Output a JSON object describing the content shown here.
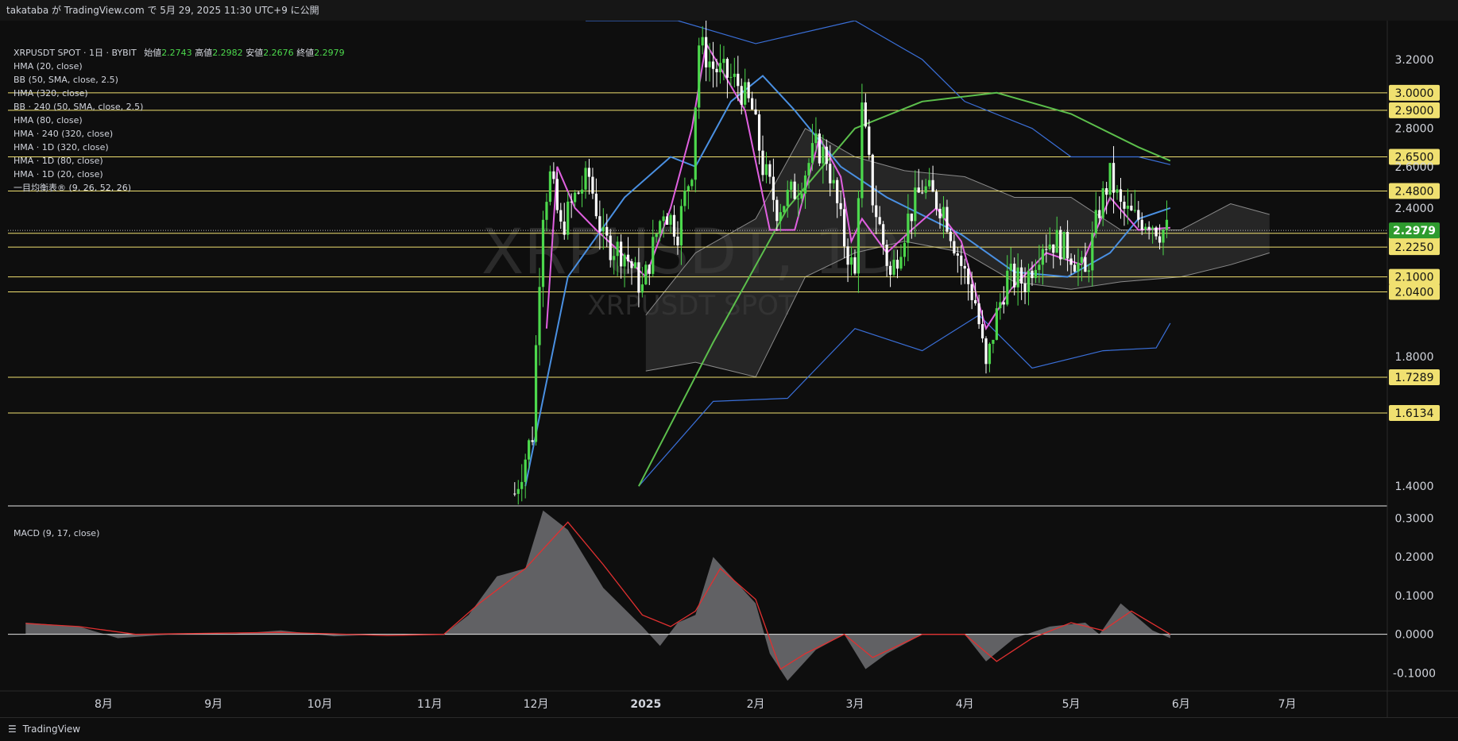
{
  "header": {
    "published_text": "takataba が TradingView.com で 5月 29, 2025 11:30 UTC+9 に公開"
  },
  "legend": {
    "symbol_line": "XRPUSDT SPOT · 1日 · BYBIT",
    "ohlc": [
      {
        "label": "始値",
        "value": "2.2743"
      },
      {
        "label": "高値",
        "value": "2.2982"
      },
      {
        "label": "安値",
        "value": "2.2676"
      },
      {
        "label": "終値",
        "value": "2.2979"
      }
    ],
    "indicators": [
      "HMA (20, close)",
      "BB (50, SMA, close, 2.5)",
      "HMA (320, close)",
      "BB · 240 (50, SMA, close, 2.5)",
      "HMA (80, close)",
      "HMA · 240 (320, close)",
      "HMA · 1D (320, close)",
      "HMA · 1D (80, close)",
      "HMA · 1D (20, close)",
      "一目均衡表® (9, 26, 52, 26)"
    ]
  },
  "watermark": {
    "main": "XRPUSDT, 1D",
    "sub": "XRPUSDT SPOT"
  },
  "macd_label": "MACD (9, 17, close)",
  "footer": {
    "brand": "TradingView"
  },
  "colors": {
    "background": "#0e0e0e",
    "up_candle": "#4cd84c",
    "down_candle": "#ffffff",
    "hma20": "#e060e0",
    "hma80": "#4a90e2",
    "hma320": "#5cbf4c",
    "bb": "#3a6fd8",
    "level_line": "#f0e070",
    "current_price_bg": "#2e9b2e",
    "macd_signal": "#e03030",
    "macd_hist": "#6a6a6e"
  },
  "chart_data": [
    {
      "type": "candlestick",
      "title": "XRPUSDT SPOT · 1日 · BYBIT",
      "scale": "log",
      "ylim": [
        1.36,
        3.45
      ],
      "x_ticks": [
        {
          "label": "8月",
          "date": "2024-08-01",
          "bold": false
        },
        {
          "label": "9月",
          "date": "2024-09-01",
          "bold": false
        },
        {
          "label": "10月",
          "date": "2024-10-01",
          "bold": false
        },
        {
          "label": "11月",
          "date": "2024-11-01",
          "bold": false
        },
        {
          "label": "12月",
          "date": "2024-12-01",
          "bold": false
        },
        {
          "label": "2025",
          "date": "2025-01-01",
          "bold": true
        },
        {
          "label": "2月",
          "date": "2025-02-01",
          "bold": false
        },
        {
          "label": "3月",
          "date": "2025-03-01",
          "bold": false
        },
        {
          "label": "4月",
          "date": "2025-04-01",
          "bold": false
        },
        {
          "label": "5月",
          "date": "2025-05-01",
          "bold": false
        },
        {
          "label": "6月",
          "date": "2025-06-01",
          "bold": false
        },
        {
          "label": "7月",
          "date": "2025-07-01",
          "bold": false
        }
      ],
      "y_ticks": [
        "3.2000",
        "2.8000",
        "2.6000",
        "2.4000",
        "1.8000",
        "1.4000"
      ],
      "horizontal_levels": [
        "3.0000",
        "2.9000",
        "2.6500",
        "2.4800",
        "2.2850",
        "2.2250",
        "2.1000",
        "2.0400",
        "1.7289",
        "1.6134"
      ],
      "current_price": "2.2979",
      "price_path": [
        [
          "2024-11-25",
          1.38
        ],
        [
          "2024-11-30",
          1.55
        ],
        [
          "2024-12-03",
          2.4
        ],
        [
          "2024-12-05",
          2.55
        ],
        [
          "2024-12-08",
          2.3
        ],
        [
          "2024-12-12",
          2.45
        ],
        [
          "2024-12-16",
          2.55
        ],
        [
          "2024-12-20",
          2.25
        ],
        [
          "2024-12-26",
          2.2
        ],
        [
          "2024-12-31",
          2.05
        ],
        [
          "2025-01-06",
          2.4
        ],
        [
          "2025-01-10",
          2.3
        ],
        [
          "2025-01-14",
          2.6
        ],
        [
          "2025-01-16",
          3.3
        ],
        [
          "2025-01-20",
          3.15
        ],
        [
          "2025-01-24",
          3.1
        ],
        [
          "2025-01-27",
          3.05
        ],
        [
          "2025-01-31",
          2.9
        ],
        [
          "2025-02-03",
          2.6
        ],
        [
          "2025-02-07",
          2.4
        ],
        [
          "2025-02-13",
          2.5
        ],
        [
          "2025-02-18",
          2.7
        ],
        [
          "2025-02-21",
          2.65
        ],
        [
          "2025-02-26",
          2.25
        ],
        [
          "2025-03-01",
          2.1
        ],
        [
          "2025-03-03",
          2.9
        ],
        [
          "2025-03-06",
          2.45
        ],
        [
          "2025-03-11",
          2.1
        ],
        [
          "2025-03-16",
          2.35
        ],
        [
          "2025-03-20",
          2.5
        ],
        [
          "2025-03-26",
          2.4
        ],
        [
          "2025-03-31",
          2.15
        ],
        [
          "2025-04-04",
          2.0
        ],
        [
          "2025-04-07",
          1.75
        ],
        [
          "2025-04-10",
          1.95
        ],
        [
          "2025-04-13",
          2.1
        ],
        [
          "2025-04-18",
          2.08
        ],
        [
          "2025-04-23",
          2.25
        ],
        [
          "2025-04-27",
          2.25
        ],
        [
          "2025-05-01",
          2.2
        ],
        [
          "2025-05-05",
          2.1
        ],
        [
          "2025-05-09",
          2.4
        ],
        [
          "2025-05-12",
          2.55
        ],
        [
          "2025-05-15",
          2.4
        ],
        [
          "2025-05-19",
          2.35
        ],
        [
          "2025-05-23",
          2.35
        ],
        [
          "2025-05-26",
          2.3
        ],
        [
          "2025-05-29",
          2.2979
        ]
      ],
      "hma20_path": [
        [
          "2024-12-04",
          1.9
        ],
        [
          "2024-12-07",
          2.6
        ],
        [
          "2024-12-12",
          2.4
        ],
        [
          "2024-12-18",
          2.3
        ],
        [
          "2024-12-25",
          2.2
        ],
        [
          "2025-01-01",
          2.1
        ],
        [
          "2025-01-08",
          2.4
        ],
        [
          "2025-01-14",
          2.8
        ],
        [
          "2025-01-18",
          3.3
        ],
        [
          "2025-01-22",
          3.15
        ],
        [
          "2025-01-29",
          2.9
        ],
        [
          "2025-02-05",
          2.3
        ],
        [
          "2025-02-12",
          2.3
        ],
        [
          "2025-02-19",
          2.75
        ],
        [
          "2025-02-25",
          2.55
        ],
        [
          "2025-02-28",
          2.25
        ],
        [
          "2025-03-03",
          2.35
        ],
        [
          "2025-03-10",
          2.2
        ],
        [
          "2025-03-17",
          2.3
        ],
        [
          "2025-03-24",
          2.4
        ],
        [
          "2025-03-31",
          2.25
        ],
        [
          "2025-04-07",
          1.9
        ],
        [
          "2025-04-14",
          2.05
        ],
        [
          "2025-04-24",
          2.2
        ],
        [
          "2025-05-04",
          2.15
        ],
        [
          "2025-05-12",
          2.45
        ],
        [
          "2025-05-20",
          2.3
        ],
        [
          "2025-05-29",
          2.31
        ]
      ],
      "hma80_path": [
        [
          "2024-11-28",
          1.4
        ],
        [
          "2024-12-10",
          2.1
        ],
        [
          "2024-12-26",
          2.45
        ],
        [
          "2025-01-08",
          2.65
        ],
        [
          "2025-01-15",
          2.6
        ],
        [
          "2025-01-25",
          2.95
        ],
        [
          "2025-02-03",
          3.1
        ],
        [
          "2025-02-12",
          2.9
        ],
        [
          "2025-02-25",
          2.6
        ],
        [
          "2025-03-10",
          2.45
        ],
        [
          "2025-03-31",
          2.28
        ],
        [
          "2025-04-15",
          2.12
        ],
        [
          "2025-04-30",
          2.1
        ],
        [
          "2025-05-12",
          2.2
        ],
        [
          "2025-05-20",
          2.35
        ],
        [
          "2025-05-29",
          2.4
        ]
      ],
      "hma320_path": [
        [
          "2024-12-30",
          1.4
        ],
        [
          "2025-01-20",
          1.85
        ],
        [
          "2025-02-10",
          2.4
        ],
        [
          "2025-03-01",
          2.8
        ],
        [
          "2025-03-20",
          2.95
        ],
        [
          "2025-04-10",
          3.0
        ],
        [
          "2025-05-01",
          2.88
        ],
        [
          "2025-05-20",
          2.7
        ],
        [
          "2025-05-29",
          2.63
        ]
      ],
      "bb_upper_path": [
        [
          "2024-12-15",
          3.45
        ],
        [
          "2025-01-10",
          3.45
        ],
        [
          "2025-02-01",
          3.3
        ],
        [
          "2025-03-01",
          3.45
        ],
        [
          "2025-03-20",
          3.2
        ],
        [
          "2025-04-01",
          2.95
        ],
        [
          "2025-04-20",
          2.8
        ],
        [
          "2025-05-01",
          2.65
        ],
        [
          "2025-05-20",
          2.65
        ],
        [
          "2025-05-29",
          2.61
        ]
      ],
      "bb_lower_path": [
        [
          "2024-12-30",
          1.4
        ],
        [
          "2025-01-20",
          1.65
        ],
        [
          "2025-02-10",
          1.66
        ],
        [
          "2025-03-01",
          1.9
        ],
        [
          "2025-03-20",
          1.82
        ],
        [
          "2025-04-05",
          1.95
        ],
        [
          "2025-04-20",
          1.76
        ],
        [
          "2025-05-10",
          1.82
        ],
        [
          "2025-05-25",
          1.83
        ],
        [
          "2025-05-29",
          1.92
        ]
      ],
      "ichimoku_cloud": {
        "upper": [
          [
            "2025-01-01",
            1.95
          ],
          [
            "2025-01-15",
            2.2
          ],
          [
            "2025-02-01",
            2.35
          ],
          [
            "2025-02-15",
            2.8
          ],
          [
            "2025-03-01",
            2.65
          ],
          [
            "2025-03-15",
            2.58
          ],
          [
            "2025-04-01",
            2.55
          ],
          [
            "2025-04-15",
            2.45
          ],
          [
            "2025-05-01",
            2.45
          ],
          [
            "2025-05-15",
            2.3
          ],
          [
            "2025-06-01",
            2.3
          ],
          [
            "2025-06-15",
            2.42
          ],
          [
            "2025-06-26",
            2.37
          ]
        ],
        "lower": [
          [
            "2025-01-01",
            1.75
          ],
          [
            "2025-01-15",
            1.78
          ],
          [
            "2025-02-01",
            1.73
          ],
          [
            "2025-02-15",
            2.1
          ],
          [
            "2025-03-01",
            2.2
          ],
          [
            "2025-03-15",
            2.25
          ],
          [
            "2025-04-01",
            2.2
          ],
          [
            "2025-04-15",
            2.08
          ],
          [
            "2025-05-01",
            2.05
          ],
          [
            "2025-05-15",
            2.08
          ],
          [
            "2025-06-01",
            2.1
          ],
          [
            "2025-06-15",
            2.15
          ],
          [
            "2025-06-26",
            2.2
          ]
        ]
      }
    },
    {
      "type": "area",
      "title": "MACD (9, 17, close)",
      "ylim": [
        -0.13,
        0.34
      ],
      "y_ticks": [
        "0.3000",
        "0.2000",
        "0.1000",
        "0.0000",
        "-0.1000"
      ],
      "histogram": [
        [
          "2024-07-10",
          0.03
        ],
        [
          "2024-07-25",
          0.02
        ],
        [
          "2024-08-05",
          -0.01
        ],
        [
          "2024-08-20",
          0.0
        ],
        [
          "2024-09-05",
          0.0
        ],
        [
          "2024-09-20",
          0.01
        ],
        [
          "2024-10-05",
          -0.005
        ],
        [
          "2024-10-20",
          0.0
        ],
        [
          "2024-11-05",
          0.0
        ],
        [
          "2024-11-12",
          0.05
        ],
        [
          "2024-11-20",
          0.15
        ],
        [
          "2024-11-28",
          0.17
        ],
        [
          "2024-12-03",
          0.32
        ],
        [
          "2024-12-10",
          0.27
        ],
        [
          "2024-12-20",
          0.12
        ],
        [
          "2024-12-31",
          0.02
        ],
        [
          "2025-01-05",
          -0.03
        ],
        [
          "2025-01-10",
          0.03
        ],
        [
          "2025-01-15",
          0.05
        ],
        [
          "2025-01-20",
          0.2
        ],
        [
          "2025-02-01",
          0.08
        ],
        [
          "2025-02-05",
          -0.05
        ],
        [
          "2025-02-10",
          -0.12
        ],
        [
          "2025-02-18",
          -0.04
        ],
        [
          "2025-02-26",
          0.0
        ],
        [
          "2025-03-04",
          -0.09
        ],
        [
          "2025-03-10",
          -0.05
        ],
        [
          "2025-03-20",
          0.0
        ],
        [
          "2025-04-01",
          0.0
        ],
        [
          "2025-04-07",
          -0.07
        ],
        [
          "2025-04-15",
          -0.01
        ],
        [
          "2025-04-25",
          0.02
        ],
        [
          "2025-05-05",
          0.03
        ],
        [
          "2025-05-09",
          0.0
        ],
        [
          "2025-05-15",
          0.08
        ],
        [
          "2025-05-24",
          0.01
        ],
        [
          "2025-05-29",
          -0.01
        ]
      ],
      "signal": [
        [
          "2024-07-10",
          0.028
        ],
        [
          "2024-07-25",
          0.02
        ],
        [
          "2024-08-10",
          0.0
        ],
        [
          "2024-09-20",
          0.005
        ],
        [
          "2024-10-20",
          -0.003
        ],
        [
          "2024-11-05",
          0.0
        ],
        [
          "2024-11-15",
          0.08
        ],
        [
          "2024-11-28",
          0.17
        ],
        [
          "2024-12-10",
          0.29
        ],
        [
          "2024-12-20",
          0.18
        ],
        [
          "2024-12-31",
          0.05
        ],
        [
          "2025-01-08",
          0.02
        ],
        [
          "2025-01-15",
          0.06
        ],
        [
          "2025-01-22",
          0.17
        ],
        [
          "2025-02-01",
          0.09
        ],
        [
          "2025-02-08",
          -0.09
        ],
        [
          "2025-02-15",
          -0.05
        ],
        [
          "2025-02-26",
          0.0
        ],
        [
          "2025-03-06",
          -0.06
        ],
        [
          "2025-03-20",
          0.0
        ],
        [
          "2025-04-01",
          0.0
        ],
        [
          "2025-04-10",
          -0.07
        ],
        [
          "2025-04-20",
          -0.01
        ],
        [
          "2025-05-01",
          0.03
        ],
        [
          "2025-05-10",
          0.01
        ],
        [
          "2025-05-18",
          0.06
        ],
        [
          "2025-05-29",
          0.0
        ]
      ]
    }
  ]
}
